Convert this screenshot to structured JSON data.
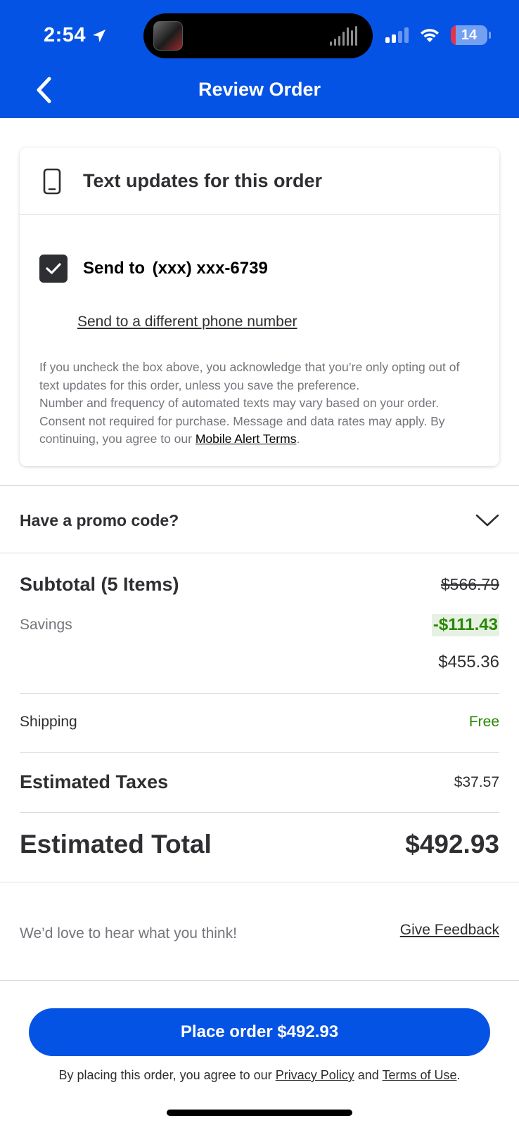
{
  "status_bar": {
    "time": "2:54",
    "battery": "14",
    "battery_level": 0.14,
    "battery_color": "#e5334a"
  },
  "header": {
    "title": "Review Order",
    "back_icon": "chevron-left-icon",
    "bg_color": "#0553e5"
  },
  "text_updates": {
    "title": "Text updates for this order",
    "icon": "phone-icon",
    "checked": true,
    "send_prefix": "Send to",
    "phone": "(xxx) xxx-6739",
    "different_link": "Send to a different phone number",
    "disclaimer_1": "If you uncheck the box above, you acknowledge that you’re only opting out of text updates for this order, unless you save the preference.",
    "disclaimer_2": "Number and frequency of automated texts may vary based on your order. Consent not required for purchase. Message and data rates may apply. By continuing, you agree to our",
    "terms_link": "Mobile Alert Terms",
    "terms_suffix": "."
  },
  "promo": {
    "label": "Have a promo code?",
    "icon": "chevron-down-icon"
  },
  "summary": {
    "subtotal_label": "Subtotal (5 Items)",
    "subtotal_original": "$566.79",
    "savings_label": "Savings",
    "savings_value": "-$111.43",
    "subtotal_after": "$455.36",
    "shipping_label": "Shipping",
    "shipping_value": "Free",
    "taxes_label": "Estimated Taxes",
    "taxes_value": "$37.57",
    "total_label": "Estimated Total",
    "total_value": "$492.93",
    "accent_green": "#2a8703"
  },
  "feedback": {
    "prompt": "We’d love to hear what you think!",
    "link": "Give Feedback"
  },
  "footer": {
    "place_order": "Place order $492.93",
    "legal_prefix": "By placing this order, you agree to our",
    "privacy_link": "Privacy Policy",
    "legal_and": "and",
    "terms_link": "Terms of Use",
    "legal_suffix": "."
  }
}
